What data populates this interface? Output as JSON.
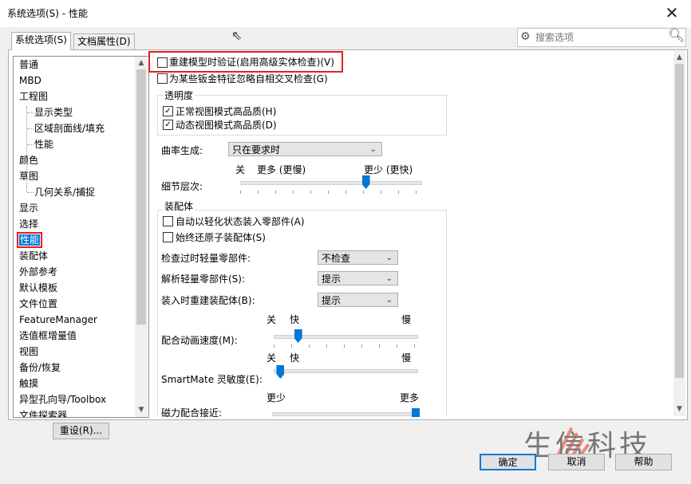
{
  "window": {
    "title": "系统选项(S) - 性能",
    "close": "✕"
  },
  "tabs": [
    {
      "label": "系统选项(S)"
    },
    {
      "label": "文档属性(D)"
    }
  ],
  "search": {
    "placeholder": "搜索选项"
  },
  "tree": {
    "items": [
      {
        "label": "普通"
      },
      {
        "label": "MBD"
      },
      {
        "label": "工程图"
      },
      {
        "label": "显示类型"
      },
      {
        "label": "区域剖面线/填充"
      },
      {
        "label": "性能"
      },
      {
        "label": "颜色"
      },
      {
        "label": "草图"
      },
      {
        "label": "几何关系/捕捉"
      },
      {
        "label": "显示"
      },
      {
        "label": "选择"
      },
      {
        "label": "性能"
      },
      {
        "label": "装配体"
      },
      {
        "label": "外部参考"
      },
      {
        "label": "默认模板"
      },
      {
        "label": "文件位置"
      },
      {
        "label": "FeatureManager"
      },
      {
        "label": "选值框增量值"
      },
      {
        "label": "视图"
      },
      {
        "label": "备份/恢复"
      },
      {
        "label": "触摸"
      },
      {
        "label": "异型孔向导/Toolbox"
      },
      {
        "label": "文件探索器"
      }
    ]
  },
  "reset_label": "重设(R)...",
  "options": {
    "rebuild_verify": "重建模型时验证(启用高级实体检查)(V)",
    "ignore_sheetmetal": "为某些钣金特征忽略自相交叉检查(G)",
    "transparency": {
      "title": "透明度",
      "normal_hq": "正常视图模式高品质(H)",
      "dynamic_hq": "动态视图模式高品质(D)"
    },
    "curvature": {
      "label": "曲率生成:",
      "value": "只在要求时"
    },
    "detail": {
      "label": "细节层次:",
      "left_label": "关",
      "more_slow": "更多 (更慢)",
      "less_fast": "更少 (更快)",
      "value_fraction": 0.7
    },
    "assembly": {
      "title": "装配体",
      "auto_lightweight": "自动以轻化状态装入零部件(A)",
      "always_resolve": "始终还原子装配体(S)",
      "check_outdated": {
        "label": "检查过时轻量零部件:",
        "value": "不检查"
      },
      "resolve_lightweight": {
        "label": "解析轻量零部件(S):",
        "value": "提示"
      },
      "rebuild_on_load": {
        "label": "装入时重建装配体(B):",
        "value": "提示"
      },
      "mate_anim": {
        "label": "配合动画速度(M):",
        "off": "关",
        "fast": "快",
        "slow": "慢",
        "value_fraction": 0.15
      },
      "smartmate": {
        "label": "SmartMate 灵敏度(E):",
        "off": "关",
        "fast": "快",
        "slow": "慢",
        "value_fraction": 0.02
      },
      "magnetic": {
        "label": "磁力配合接近:",
        "less": "更少",
        "more": "更多",
        "value_fraction": 1.0
      }
    }
  },
  "buttons": {
    "ok": "确定",
    "cancel": "取消",
    "help": "帮助"
  },
  "watermark": {
    "text": "生信科技"
  },
  "colors": {
    "accent": "#0078d7",
    "highlight": "#e02020"
  }
}
